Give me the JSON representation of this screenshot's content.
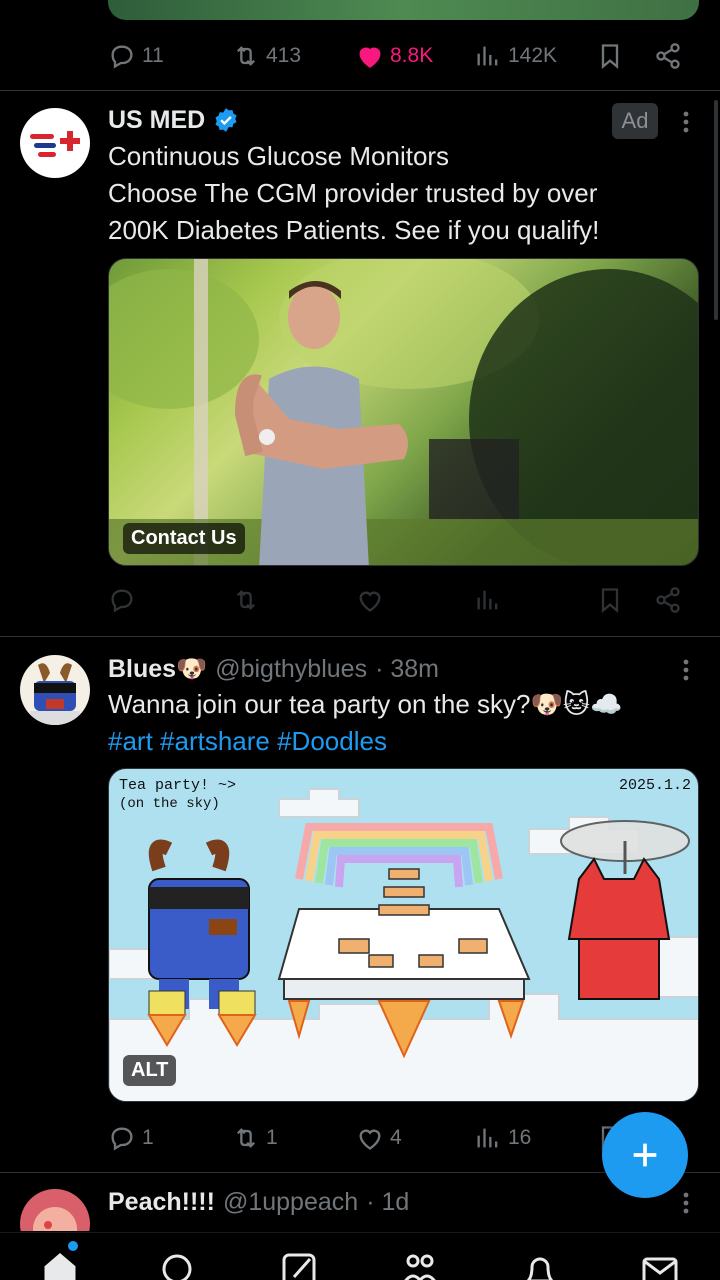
{
  "prev_post": {
    "replies": "11",
    "reposts": "413",
    "likes": "8.8K",
    "views": "142K"
  },
  "ad_post": {
    "name": "US MED",
    "ad_label": "Ad",
    "text_line1": "Continuous Glucose Monitors",
    "text_line2": "Choose The CGM provider trusted by over",
    "text_line3": "200K Diabetes Patients. See if you qualify!",
    "cta": "Contact Us"
  },
  "blues_post": {
    "name": "Blues🐶",
    "handle": "@bigthyblues",
    "time": "· 38m",
    "text": "Wanna join our tea party on the sky?🐶🐱☁️",
    "hashtags": "#art #artshare #Doodles",
    "image_caption_left": "Tea party! ~> (on the sky)",
    "image_caption_right": "2025.1.2",
    "alt_badge": "ALT",
    "replies": "1",
    "reposts": "1",
    "likes": "4",
    "views": "16"
  },
  "peach_post": {
    "name": "Peach!!!!",
    "handle": "@1uppeach",
    "time": "· 1d"
  },
  "colors": {
    "accent": "#1d9bf0",
    "like": "#f91880",
    "background": "#000000",
    "muted": "#71767b"
  },
  "icons": [
    "reply-icon",
    "repost-icon",
    "heart-icon",
    "views-icon",
    "bookmark-icon",
    "share-icon",
    "verified-icon",
    "more-icon",
    "compose-icon",
    "home-icon",
    "search-icon",
    "grok-icon",
    "communities-icon",
    "notifications-icon",
    "messages-icon"
  ]
}
